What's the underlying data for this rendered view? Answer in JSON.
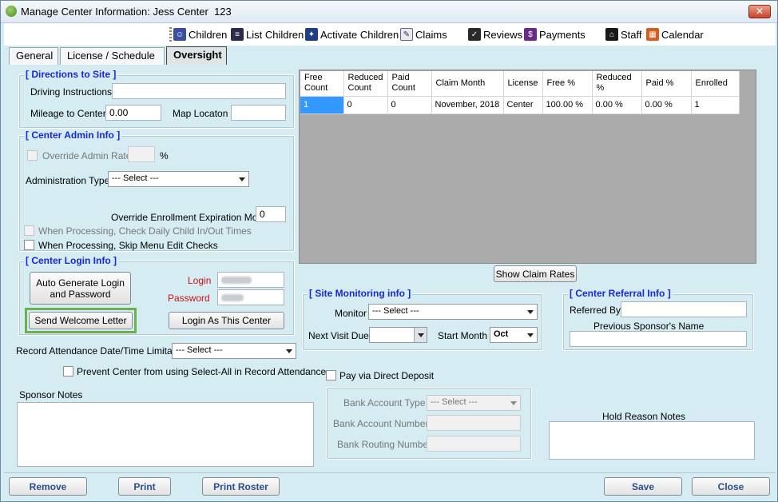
{
  "window": {
    "title": "Manage Center Information: Jess Center",
    "title_id": "123",
    "close": "✕"
  },
  "toolbar": {
    "items": [
      {
        "label": "Children",
        "icon": "children-icon"
      },
      {
        "label": "List Children",
        "icon": "list-children-icon"
      },
      {
        "label": "Activate Children",
        "icon": "activate-children-icon"
      },
      {
        "label": "Claims",
        "icon": "claims-icon"
      },
      {
        "label": "Reviews",
        "icon": "reviews-icon"
      },
      {
        "label": "Payments",
        "icon": "payments-icon"
      },
      {
        "label": "Staff",
        "icon": "staff-icon"
      },
      {
        "label": "Calendar",
        "icon": "calendar-icon"
      }
    ]
  },
  "tabs": [
    {
      "label": "General",
      "active": false
    },
    {
      "label": "License / Schedule",
      "active": false
    },
    {
      "label": "Oversight",
      "active": true
    }
  ],
  "directions": {
    "legend": "[ Directions to Site ]",
    "driving_label": "Driving Instructions",
    "driving_value": "",
    "mileage_label": "Mileage to Center",
    "mileage_value": "0.00",
    "map_label": "Map Locaton",
    "map_value": ""
  },
  "admin": {
    "legend": "[ Center Admin Info ]",
    "override_rate_label": "Override Admin Rate",
    "override_rate_value": "",
    "percent": "%",
    "admin_type_label": "Administration Type",
    "admin_type_value": "--- Select ---",
    "override_exp_label": "Override Enrollment Expiration Month",
    "override_exp_value": "0",
    "check_inout_label": "When Processing, Check Daily Child In/Out Times",
    "skip_menu_label": "When Processing, Skip Menu Edit Checks"
  },
  "login": {
    "legend": "[ Center Login Info ]",
    "auto_generate": "Auto Generate Login and Password",
    "login_label": "Login",
    "password_label": "Password",
    "send_welcome": "Send Welcome Letter",
    "login_as": "Login As This Center"
  },
  "attendance": {
    "limit_label": "Record Attendance Date/Time Limitation",
    "limit_value": "--- Select ---",
    "prevent_label": "Prevent Center from using Select-All in Record Attendance"
  },
  "sponsor_notes_label": "Sponsor Notes",
  "claims_grid": {
    "headers": [
      "Free Count",
      "Reduced Count",
      "Paid Count",
      "Claim Month",
      "License",
      "Free %",
      "Reduced %",
      "Paid %",
      "Enrolled"
    ],
    "rows": [
      [
        "1",
        "0",
        "0",
        "November, 2018",
        "Center",
        "100.00 %",
        "0.00 %",
        "0.00 %",
        "1"
      ]
    ],
    "show_rates": "Show Claim Rates"
  },
  "monitoring": {
    "legend": "[ Site Monitoring info ]",
    "monitor_label": "Monitor",
    "monitor_value": "--- Select ---",
    "next_visit_label": "Next Visit Due",
    "next_visit_value": "",
    "start_month_label": "Start Month",
    "start_month_value": "Oct"
  },
  "referral": {
    "legend": "[ Center Referral Info ]",
    "referred_by_label": "Referred By",
    "referred_by_value": "",
    "prev_sponsor_label": "Previous Sponsor's Name",
    "prev_sponsor_value": ""
  },
  "deposit": {
    "pay_label": "Pay via Direct Deposit",
    "account_type_label": "Bank Account Type",
    "account_type_value": "--- Select ---",
    "account_number_label": "Bank Account Number",
    "routing_label": "Bank Routing Number"
  },
  "hold_notes_label": "Hold Reason Notes",
  "bottom": {
    "remove": "Remove",
    "print": "Print",
    "print_roster": "Print Roster",
    "save": "Save",
    "close": "Close"
  },
  "colors": {
    "background": "#d4ecf2",
    "legend": "#1a28d8",
    "required": "#d01010",
    "highlight": "#6ab04c",
    "selection": "#3399ff"
  }
}
